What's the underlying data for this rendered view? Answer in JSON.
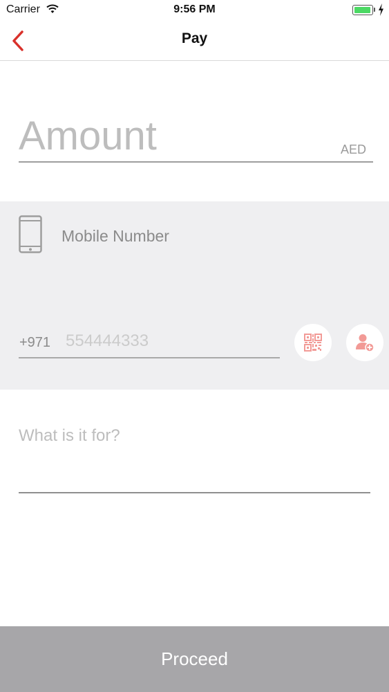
{
  "status_bar": {
    "carrier": "Carrier",
    "time": "9:56 PM",
    "battery_level_percent": 100,
    "icons": [
      "wifi-icon",
      "battery-icon",
      "charging-bolt-icon"
    ]
  },
  "nav": {
    "title": "Pay",
    "back_icon": "chevron-left-icon"
  },
  "amount": {
    "placeholder": "Amount",
    "value": "",
    "currency": "AED"
  },
  "mobile": {
    "icon": "smartphone-icon",
    "label": "Mobile Number",
    "country_code": "+971",
    "placeholder": "554444333",
    "value": "",
    "scan_button_icon": "qr-code-icon",
    "contact_button_icon": "add-contact-icon"
  },
  "purpose": {
    "placeholder": "What is it for?",
    "value": ""
  },
  "footer": {
    "proceed_label": "Proceed"
  },
  "colors": {
    "accent": "#d9312b",
    "icon_tint": "#f29a96",
    "section_background": "#efeff1",
    "proceed_background": "#a7a6a9"
  }
}
